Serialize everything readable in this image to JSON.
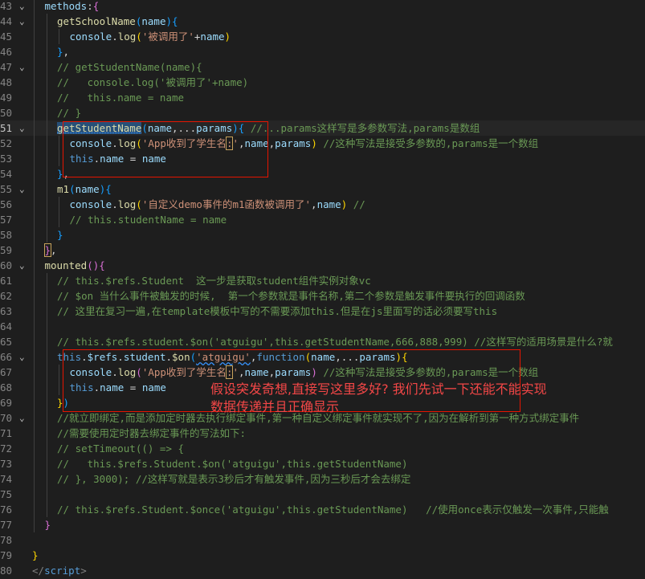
{
  "colors": {
    "background": "#1e1e1e",
    "comment": "#6a9955",
    "string": "#ce9178",
    "function": "#dcdcaa",
    "property": "#9cdcfe",
    "keyword": "#569cd6",
    "annotation_red": "#e51400"
  },
  "lines": [
    {
      "num": "43",
      "fold": "⌄",
      "indent": 2,
      "tokens": [
        [
          "methods",
          "prop"
        ],
        [
          ":",
          "plain"
        ],
        [
          "{",
          "br2"
        ]
      ]
    },
    {
      "num": "44",
      "fold": "⌄",
      "indent": 3,
      "tokens": [
        [
          "getSchoolName",
          "fn"
        ],
        [
          "(",
          "br3"
        ],
        [
          "name",
          "prop"
        ],
        [
          ")",
          "br3"
        ],
        [
          "{",
          "br3"
        ]
      ]
    },
    {
      "num": "45",
      "indent": 4,
      "tokens": [
        [
          "console",
          "prop"
        ],
        [
          ".",
          "plain"
        ],
        [
          "log",
          "fn"
        ],
        [
          "(",
          "br1"
        ],
        [
          "'被调用了'",
          "str"
        ],
        [
          "+",
          "plain"
        ],
        [
          "name",
          "prop"
        ],
        [
          ")",
          "br1"
        ]
      ]
    },
    {
      "num": "46",
      "indent": 3,
      "tokens": [
        [
          "}",
          "br3"
        ],
        [
          ",",
          "plain"
        ]
      ]
    },
    {
      "num": "47",
      "fold": "⌄",
      "indent": 3,
      "tokens": [
        [
          "// getStudentName(name){",
          "cm"
        ]
      ]
    },
    {
      "num": "48",
      "indent": 3,
      "tokens": [
        [
          "//   console.log('被调用了'+name)",
          "cm"
        ]
      ]
    },
    {
      "num": "49",
      "indent": 3,
      "tokens": [
        [
          "//   this.name = name",
          "cm"
        ]
      ]
    },
    {
      "num": "50",
      "indent": 3,
      "tokens": [
        [
          "// }",
          "cm"
        ]
      ]
    },
    {
      "num": "51",
      "fold": "⌄",
      "indent": 3,
      "active": true,
      "tokens": [
        [
          "getStudentName",
          "fn sel"
        ],
        [
          "(",
          "br3"
        ],
        [
          "name",
          "prop"
        ],
        [
          ",",
          "plain"
        ],
        [
          "...",
          "plain"
        ],
        [
          "params",
          "prop"
        ],
        [
          ")",
          "br3"
        ],
        [
          "{",
          "br3"
        ],
        [
          " //...params这样写是多参数写法,params是数组",
          "cm"
        ]
      ]
    },
    {
      "num": "52",
      "indent": 4,
      "tokens": [
        [
          "console",
          "prop"
        ],
        [
          ".",
          "plain"
        ],
        [
          "log",
          "fn"
        ],
        [
          "(",
          "br1"
        ],
        [
          "'App收到了学生名",
          "str"
        ],
        [
          ":",
          "str box"
        ],
        [
          "'",
          "str"
        ],
        [
          ",",
          "plain"
        ],
        [
          "name",
          "prop"
        ],
        [
          ",",
          "plain"
        ],
        [
          "params",
          "prop"
        ],
        [
          ")",
          "br1"
        ],
        [
          " //这种写法是接受多参数的,params是一个数组",
          "cm"
        ]
      ]
    },
    {
      "num": "53",
      "indent": 4,
      "tokens": [
        [
          "this",
          "kw"
        ],
        [
          ".",
          "plain"
        ],
        [
          "name",
          "prop"
        ],
        [
          " = ",
          "plain"
        ],
        [
          "name",
          "prop"
        ]
      ]
    },
    {
      "num": "54",
      "indent": 3,
      "tokens": [
        [
          "}",
          "br3"
        ],
        [
          ",",
          "plain"
        ]
      ]
    },
    {
      "num": "55",
      "fold": "⌄",
      "indent": 3,
      "tokens": [
        [
          "m1",
          "fn"
        ],
        [
          "(",
          "br3"
        ],
        [
          "name",
          "prop"
        ],
        [
          ")",
          "br3"
        ],
        [
          "{",
          "br3"
        ]
      ]
    },
    {
      "num": "56",
      "indent": 4,
      "tokens": [
        [
          "console",
          "prop"
        ],
        [
          ".",
          "plain"
        ],
        [
          "log",
          "fn"
        ],
        [
          "(",
          "br1"
        ],
        [
          "'自定义demo事件的m1函数被调用了'",
          "str"
        ],
        [
          ",",
          "plain"
        ],
        [
          "name",
          "prop"
        ],
        [
          ")",
          "br1"
        ],
        [
          " //",
          "cm"
        ]
      ]
    },
    {
      "num": "57",
      "indent": 4,
      "tokens": [
        [
          "// this.studentName = name",
          "cm"
        ]
      ]
    },
    {
      "num": "58",
      "indent": 3,
      "tokens": [
        [
          "}",
          "br3"
        ]
      ]
    },
    {
      "num": "59",
      "indent": 2,
      "tokens": [
        [
          "}",
          "br2 box"
        ],
        [
          ",",
          "plain"
        ]
      ]
    },
    {
      "num": "60",
      "fold": "⌄",
      "indent": 2,
      "tokens": [
        [
          "mounted",
          "fn"
        ],
        [
          "(",
          "br2"
        ],
        [
          ")",
          "br2"
        ],
        [
          "{",
          "br2"
        ]
      ]
    },
    {
      "num": "61",
      "indent": 3,
      "tokens": [
        [
          "// this.$refs.Student  这一步是获取student组件实例对象vc",
          "cm"
        ]
      ]
    },
    {
      "num": "62",
      "indent": 3,
      "tokens": [
        [
          "// $on 当什么事件被触发的时候,  第一个参数就是事件名称,第二个参数是触发事件要执行的回调函数",
          "cm"
        ]
      ]
    },
    {
      "num": "63",
      "indent": 3,
      "tokens": [
        [
          "// 这里在复习一遍,在template模板中写的不需要添加this.但是在js里面写的话必须要写this",
          "cm"
        ]
      ]
    },
    {
      "num": "64",
      "indent": 3,
      "tokens": []
    },
    {
      "num": "65",
      "indent": 3,
      "tokens": [
        [
          "// this.$refs.student.$on('atguigu',this.getStudentName,666,888,999) //这样写的适用场景是什么?就",
          "cm"
        ]
      ]
    },
    {
      "num": "66",
      "fold": "⌄",
      "indent": 3,
      "tokens": [
        [
          "this",
          "kw"
        ],
        [
          ".",
          "plain"
        ],
        [
          "$refs",
          "prop"
        ],
        [
          ".",
          "plain"
        ],
        [
          "student",
          "prop"
        ],
        [
          ".",
          "plain"
        ],
        [
          "$on",
          "fn"
        ],
        [
          "(",
          "br3"
        ],
        [
          "'atguigu'",
          "str squig"
        ],
        [
          ",",
          "plain"
        ],
        [
          "function",
          "kw"
        ],
        [
          "(",
          "br1"
        ],
        [
          "name",
          "prop"
        ],
        [
          ",",
          "plain"
        ],
        [
          "...",
          "plain"
        ],
        [
          "params",
          "prop"
        ],
        [
          ")",
          "br1"
        ],
        [
          "{",
          "br1"
        ]
      ]
    },
    {
      "num": "67",
      "indent": 4,
      "tokens": [
        [
          "console",
          "prop"
        ],
        [
          ".",
          "plain"
        ],
        [
          "log",
          "fn"
        ],
        [
          "(",
          "br2"
        ],
        [
          "'App收到了学生名",
          "str"
        ],
        [
          ":",
          "str box"
        ],
        [
          "'",
          "str"
        ],
        [
          ",",
          "plain"
        ],
        [
          "name",
          "prop"
        ],
        [
          ",",
          "plain"
        ],
        [
          "params",
          "prop"
        ],
        [
          ")",
          "br2"
        ],
        [
          " //这种写法是接受多参数的,params是一个数组",
          "cm"
        ]
      ]
    },
    {
      "num": "68",
      "indent": 4,
      "tokens": [
        [
          "this",
          "kw"
        ],
        [
          ".",
          "plain"
        ],
        [
          "name",
          "prop"
        ],
        [
          " = ",
          "plain"
        ],
        [
          "name",
          "prop"
        ]
      ]
    },
    {
      "num": "69",
      "indent": 3,
      "tokens": [
        [
          "}",
          "br1"
        ],
        [
          ")",
          "br3"
        ]
      ]
    },
    {
      "num": "70",
      "fold": "⌄",
      "indent": 3,
      "tokens": [
        [
          "//就立即绑定,而是添加定时器去执行绑定事件,第一种自定义绑定事件就实现不了,因为在解析到第一种方式绑定事件",
          "cm"
        ]
      ]
    },
    {
      "num": "71",
      "indent": 3,
      "tokens": [
        [
          "//需要使用定时器去绑定事件的写法如下:",
          "cm"
        ]
      ]
    },
    {
      "num": "72",
      "indent": 3,
      "tokens": [
        [
          "// setTimeout(() => {",
          "cm"
        ]
      ]
    },
    {
      "num": "73",
      "indent": 3,
      "tokens": [
        [
          "//   this.$refs.Student.$on('atguigu',this.getStudentName)",
          "cm"
        ]
      ]
    },
    {
      "num": "74",
      "indent": 3,
      "tokens": [
        [
          "// }, 3000); //这样写就是表示3秒后才有触发事件,因为三秒后才会去绑定",
          "cm"
        ]
      ]
    },
    {
      "num": "75",
      "indent": 3,
      "tokens": []
    },
    {
      "num": "76",
      "indent": 3,
      "tokens": [
        [
          "// this.$refs.Student.$once('atguigu',this.getStudentName)   //使用once表示仅触发一次事件,只能触",
          "cm"
        ]
      ]
    },
    {
      "num": "77",
      "indent": 2,
      "tokens": [
        [
          "}",
          "br2"
        ]
      ]
    },
    {
      "num": "78",
      "indent": 1,
      "tokens": []
    },
    {
      "num": "79",
      "indent": 1,
      "tokens": [
        [
          "}",
          "br1"
        ]
      ]
    },
    {
      "num": "80",
      "indent": 1,
      "tokens": [
        [
          "</",
          "tag"
        ],
        [
          "script",
          "tagname"
        ],
        [
          ">",
          "tag"
        ]
      ]
    }
  ],
  "annotation": {
    "line1": "假设突发奇想,直接写这里多好? 我们先试一下还能不能实现",
    "line2": "数据传递并且正确显示"
  }
}
